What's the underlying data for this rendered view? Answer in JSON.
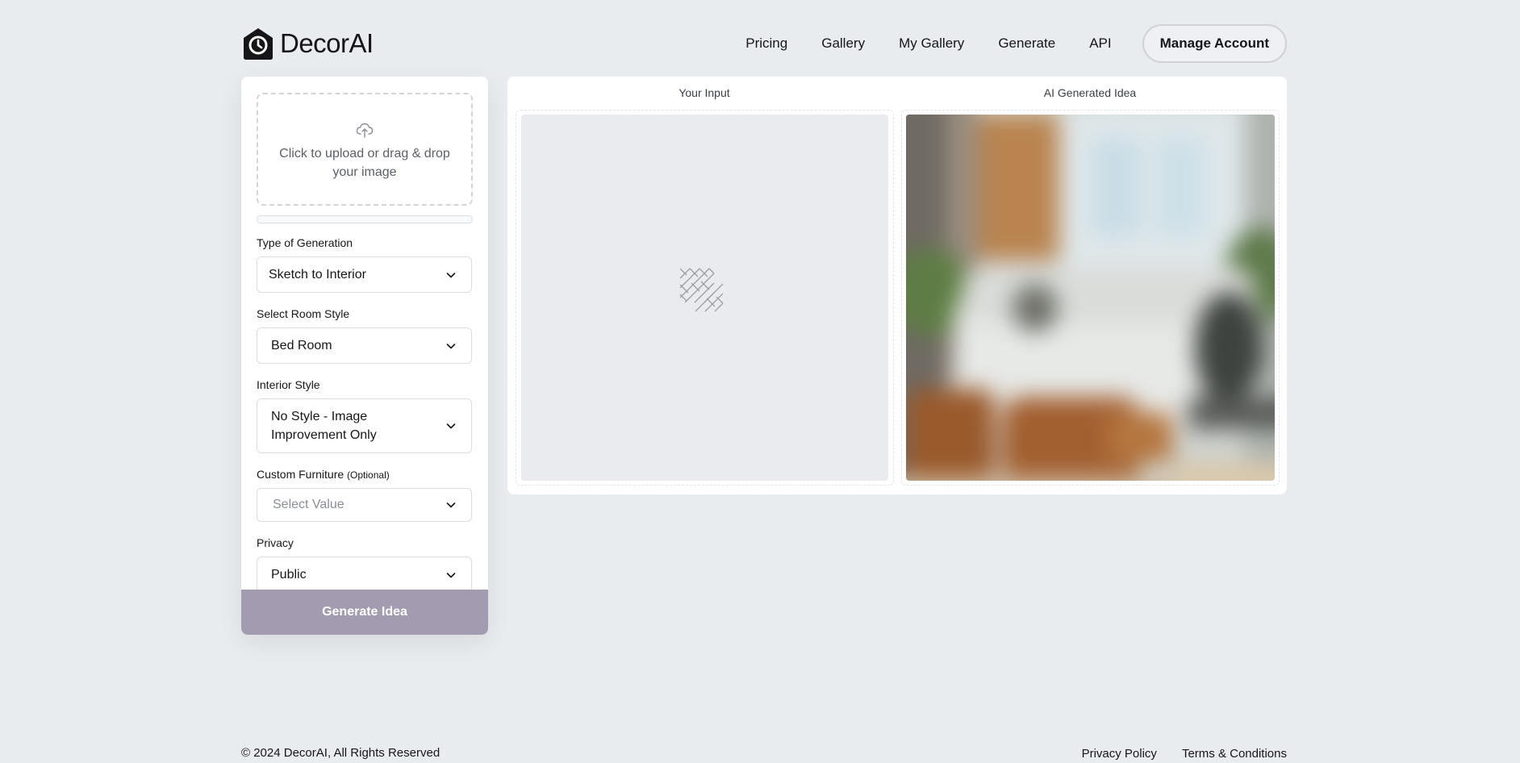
{
  "brand": {
    "name": "DecorAI",
    "logo_icon": "house-clock-icon"
  },
  "nav": {
    "links": [
      "Pricing",
      "Gallery",
      "My Gallery",
      "Generate",
      "API"
    ],
    "manage_account": "Manage Account"
  },
  "upload": {
    "text": "Click to upload or drag & drop your image",
    "icon": "cloud-upload-icon"
  },
  "form": {
    "generation_type": {
      "label": "Type of Generation",
      "value": "Sketch to Interior"
    },
    "room_style": {
      "label": "Select Room Style",
      "value": "Bed Room"
    },
    "interior_style": {
      "label": "Interior Style",
      "value": "No Style - Image Improvement Only"
    },
    "custom_furniture": {
      "label": "Custom Furniture",
      "optional": "(Optional)",
      "placeholder": "Select Value"
    },
    "privacy": {
      "label": "Privacy",
      "value": "Public"
    },
    "generate_label": "Generate Idea"
  },
  "preview": {
    "input_label": "Your Input",
    "output_label": "AI Generated Idea"
  },
  "footer": {
    "copyright": "© 2024 DecorAI, All Rights Reserved",
    "links": [
      "Privacy Policy",
      "Terms & Conditions"
    ]
  },
  "colors": {
    "background": "#e9ecef",
    "generate_button": "#a39cb0",
    "card": "#ffffff"
  }
}
